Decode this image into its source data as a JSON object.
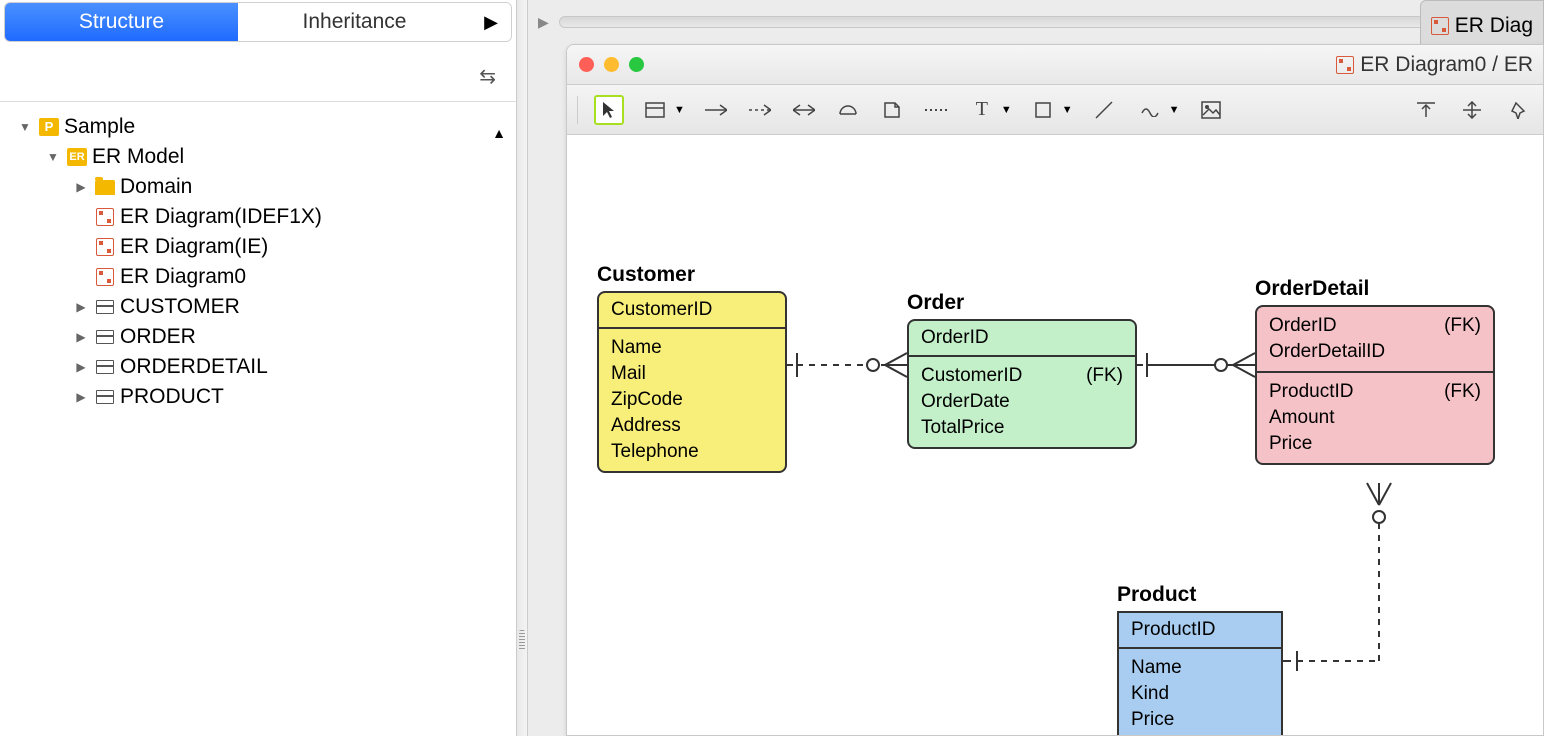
{
  "sidebar": {
    "tabs": {
      "structure": "Structure",
      "inheritance": "Inheritance"
    },
    "tree": {
      "root": "Sample",
      "model": "ER Model",
      "domain": "Domain",
      "diag_idef1x": "ER Diagram(IDEF1X)",
      "diag_ie": "ER Diagram(IE)",
      "diag0": "ER Diagram0",
      "t_customer": "CUSTOMER",
      "t_order": "ORDER",
      "t_orderdetail": "ORDERDETAIL",
      "t_product": "PRODUCT"
    }
  },
  "right": {
    "tab_label": "ER Diag",
    "win_title": "ER Diagram0 / ER"
  },
  "entities": {
    "customer": {
      "title": "Customer",
      "pk": "CustomerID",
      "a1": "Name",
      "a2": "Mail",
      "a3": "ZipCode",
      "a4": "Address",
      "a5": "Telephone"
    },
    "order": {
      "title": "Order",
      "pk": "OrderID",
      "a1": "CustomerID",
      "a1fk": "(FK)",
      "a2": "OrderDate",
      "a3": "TotalPrice"
    },
    "orderdetail": {
      "title": "OrderDetail",
      "pk1": "OrderID",
      "pk1fk": "(FK)",
      "pk2": "OrderDetailID",
      "a1": "ProductID",
      "a1fk": "(FK)",
      "a2": "Amount",
      "a3": "Price"
    },
    "product": {
      "title": "Product",
      "pk": "ProductID",
      "a1": "Name",
      "a2": "Kind",
      "a3": "Price"
    }
  }
}
